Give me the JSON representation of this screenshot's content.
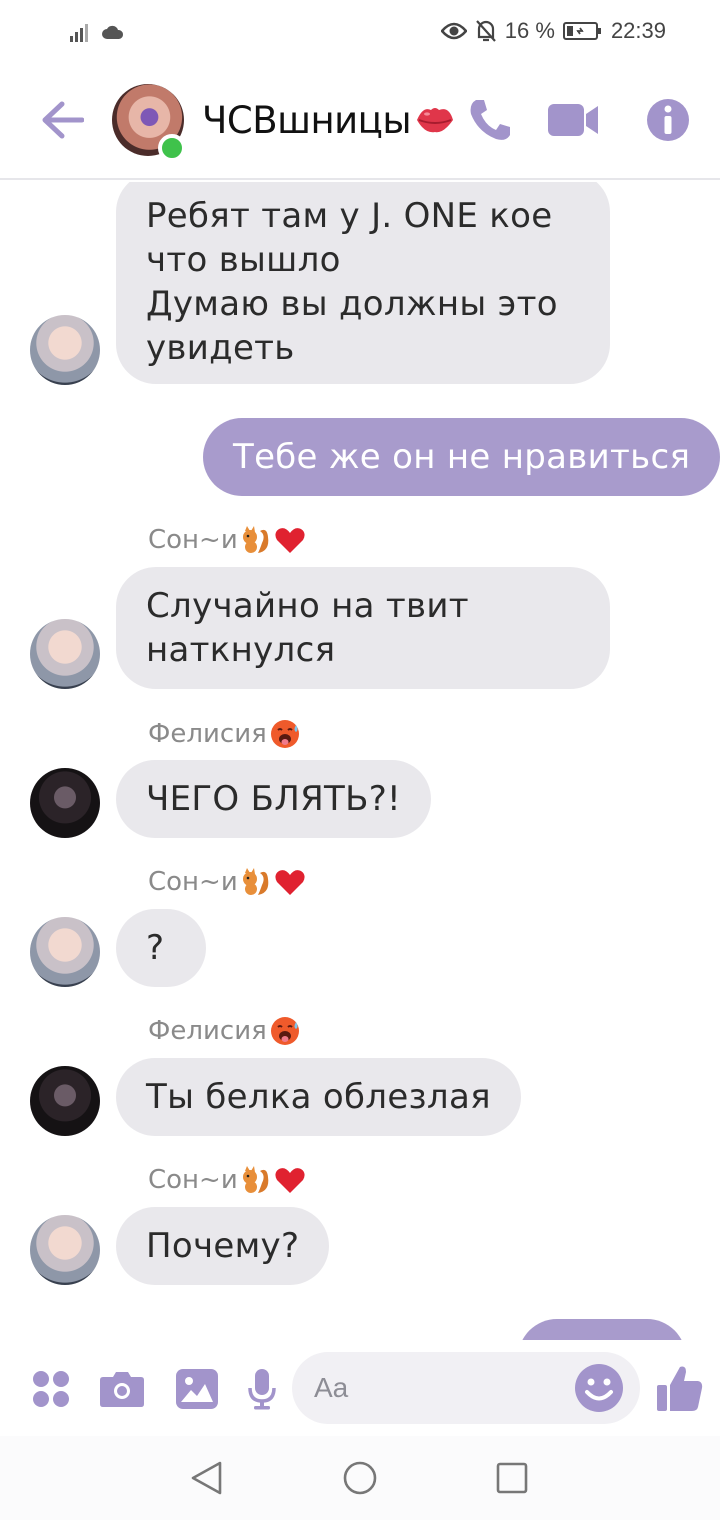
{
  "status_bar": {
    "battery_percent": "16 %",
    "time": "22:39"
  },
  "header": {
    "chat_title": "ЧСВшницы",
    "title_emoji": "kiss-lips-emoji"
  },
  "messages": [
    {
      "type": "incoming",
      "avatar": "boy",
      "lines": [
        "Ребят там у J. ONE кое",
        "что вышло",
        "Думаю вы должны это",
        "увидеть"
      ]
    },
    {
      "type": "outgoing",
      "text": "Тебе же он не нравиться"
    },
    {
      "type": "incoming",
      "sender": "Сон~и",
      "sender_emojis": [
        "squirrel-emoji",
        "red-heart-emoji"
      ],
      "avatar": "boy",
      "lines": [
        "Случайно на твит",
        "наткнулся"
      ]
    },
    {
      "type": "incoming",
      "sender": "Фелисия",
      "sender_emojis": [
        "hot-face-emoji"
      ],
      "avatar": "dark",
      "text": "ЧЕГО БЛЯТЬ?!"
    },
    {
      "type": "incoming",
      "sender": "Сон~и",
      "sender_emojis": [
        "squirrel-emoji",
        "red-heart-emoji"
      ],
      "avatar": "boy",
      "text": "?"
    },
    {
      "type": "incoming",
      "sender": "Фелисия",
      "sender_emojis": [
        "hot-face-emoji"
      ],
      "avatar": "dark",
      "text": "Ты белка облезлая"
    },
    {
      "type": "incoming",
      "sender": "Сон~и",
      "sender_emojis": [
        "squirrel-emoji",
        "red-heart-emoji"
      ],
      "avatar": "boy",
      "text": "Почему?"
    },
    {
      "type": "outgoing",
      "text": ""
    }
  ],
  "composer": {
    "placeholder": "Aa"
  },
  "colors": {
    "accent": "#a89bcc",
    "incoming_bubble": "#e9e8ec",
    "outgoing_bubble": "#a89bcc",
    "online": "#3fc24b"
  }
}
